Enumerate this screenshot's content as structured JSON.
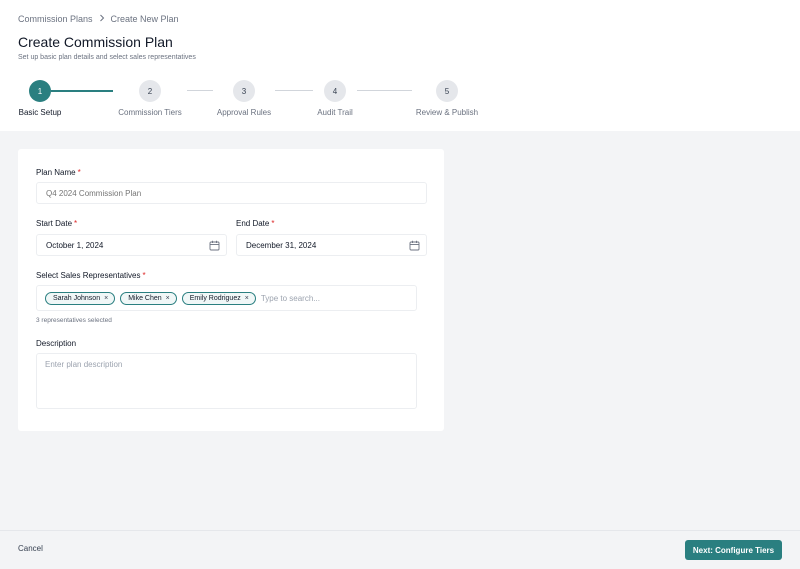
{
  "breadcrumb": {
    "items": [
      "Commission Plans",
      "Create New Plan"
    ],
    "separator": ">"
  },
  "header": {
    "title": "Create Commission Plan",
    "subtitle": "Set up basic plan details and select sales representatives"
  },
  "stepper": {
    "steps": [
      {
        "number": "1",
        "label": "Basic Setup"
      },
      {
        "number": "2",
        "label": "Commission Tiers"
      },
      {
        "number": "3",
        "label": "Approval Rules"
      },
      {
        "number": "4",
        "label": "Audit Trail"
      },
      {
        "number": "5",
        "label": "Review & Publish"
      }
    ],
    "active_step": 1
  },
  "form": {
    "plan_name": {
      "label": "Plan Name",
      "required": "*",
      "placeholder": "Q4 2024 Commission Plan"
    },
    "start_date": {
      "label": "Start Date",
      "required": "*",
      "value": "October 1, 2024"
    },
    "end_date": {
      "label": "End Date",
      "required": "*",
      "value": "December 31, 2024"
    },
    "reps": {
      "label": "Select Sales Representatives",
      "required": "*",
      "tags": [
        "Sarah Johnson",
        "Mike Chen",
        "Emily Rodriguez"
      ],
      "remove_glyph": "×",
      "search_placeholder": "Type to search...",
      "helper": "3 representatives selected"
    },
    "description": {
      "label": "Description",
      "placeholder": "Enter plan description"
    }
  },
  "footer": {
    "cancel_label": "Cancel",
    "next_label": "Next: Configure Tiers"
  },
  "colors": {
    "accent": "#2a7f80",
    "required": "#dc2626"
  },
  "icons": {
    "breadcrumb_separator": "chevron-right-icon",
    "date_field": "calendar-icon",
    "tag_remove": "close-icon"
  }
}
